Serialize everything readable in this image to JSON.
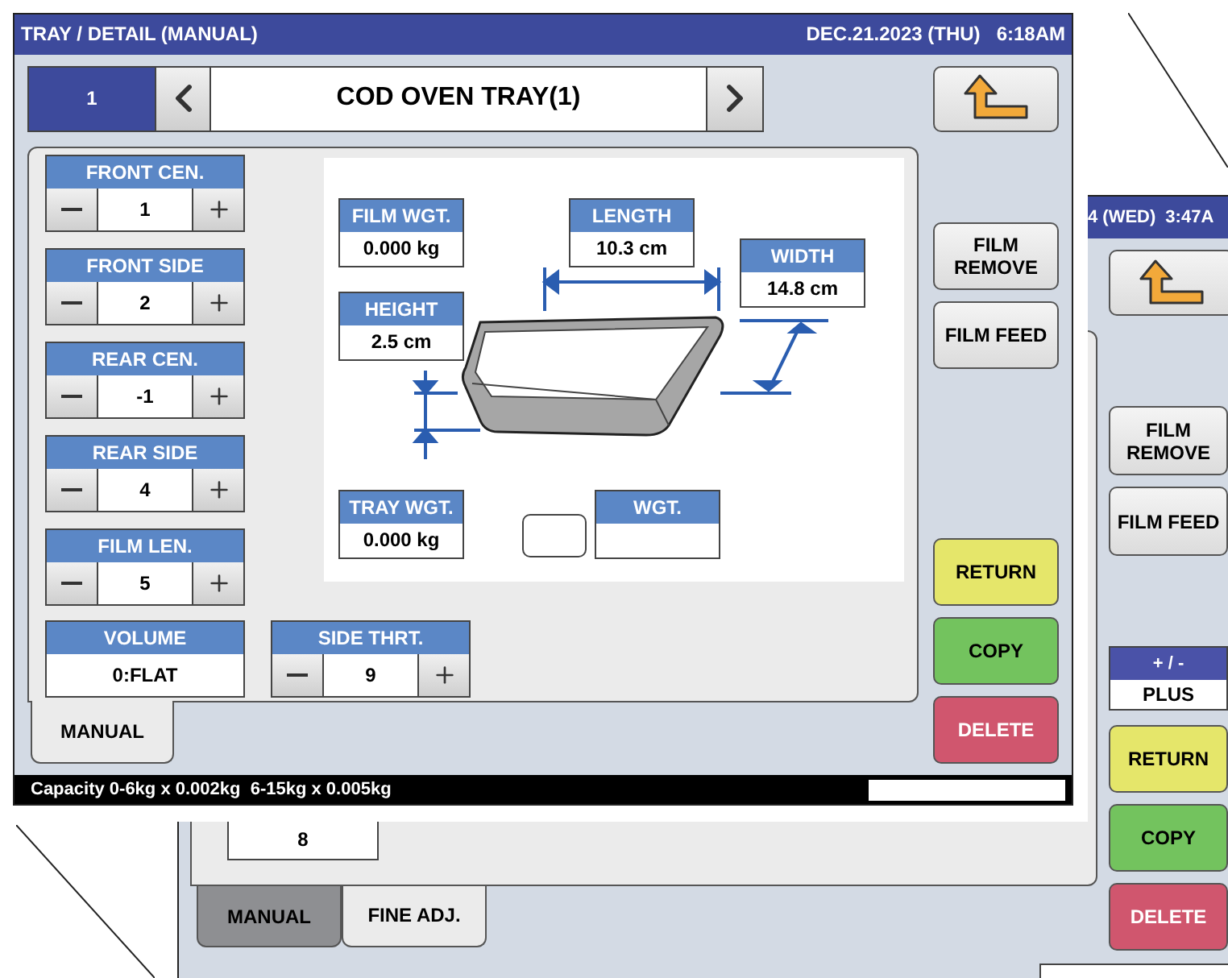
{
  "back_screen": {
    "date": "4 (WED)",
    "time": "3:47A",
    "tool_buttons": [
      {
        "label": "FILM REMOVE",
        "kind": "plain"
      },
      {
        "label": "FILM FEED",
        "kind": "plain"
      }
    ],
    "sign_setting": {
      "label": "+ / -",
      "value": "PLUS"
    },
    "action_buttons": [
      {
        "label": "RETURN",
        "kind": "return"
      },
      {
        "label": "COPY",
        "kind": "copy"
      },
      {
        "label": "DELETE",
        "kind": "delete"
      }
    ],
    "value_box": {
      "value": "8"
    },
    "tabs": [
      {
        "label": "MANUAL",
        "selected": false
      },
      {
        "label": "FINE ADJ.",
        "selected": true
      }
    ]
  },
  "main_screen": {
    "title": "TRAY / DETAIL (MANUAL)",
    "date": "DEC.21.2023 (THU)",
    "time": "6:18AM",
    "tray_number": "1",
    "tray_name": "COD OVEN TRAY(1)",
    "spinners": [
      {
        "label": "FRONT CEN.",
        "value": "1"
      },
      {
        "label": "FRONT SIDE",
        "value": "2"
      },
      {
        "label": "REAR CEN.",
        "value": "-1"
      },
      {
        "label": "REAR SIDE",
        "value": "4"
      },
      {
        "label": "FILM LEN.",
        "value": "5"
      }
    ],
    "volume": {
      "label": "VOLUME",
      "value": "0:FLAT"
    },
    "side_thrust": {
      "label": "SIDE THRT.",
      "value": "9"
    },
    "measurements": [
      {
        "label": "FILM WGT.",
        "value": "0.000 kg"
      },
      {
        "label": "LENGTH",
        "value": "10.3 cm"
      },
      {
        "label": "WIDTH",
        "value": "14.8 cm"
      },
      {
        "label": "HEIGHT",
        "value": "2.5 cm"
      },
      {
        "label": "TRAY WGT.",
        "value": "0.000 kg"
      },
      {
        "label": "WGT."
      }
    ],
    "tool_buttons": [
      {
        "label": "FILM REMOVE",
        "kind": "plain"
      },
      {
        "label": "FILM FEED",
        "kind": "plain"
      }
    ],
    "action_buttons": [
      {
        "label": "RETURN",
        "kind": "return"
      },
      {
        "label": "COPY",
        "kind": "copy"
      },
      {
        "label": "DELETE",
        "kind": "delete"
      }
    ],
    "tabs": [
      {
        "label": "MANUAL",
        "selected": true
      }
    ],
    "status_bar": "Capacity 0-6kg x 0.002kg  6-15kg x 0.005kg"
  }
}
